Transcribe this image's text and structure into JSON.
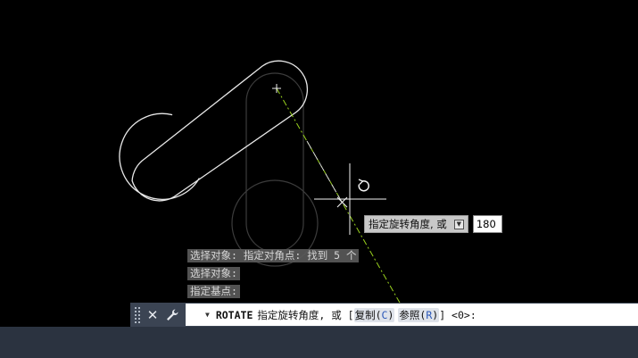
{
  "command_history": [
    "选择对象: 指定对角点: 找到 5 个",
    "选择对象:",
    "指定基点:"
  ],
  "dynamic_input": {
    "prompt": "指定旋转角度, 或",
    "value": "180"
  },
  "command_line": {
    "command": "ROTATE",
    "prompt": "指定旋转角度, 或 [",
    "options": [
      {
        "label": "复制(",
        "key": "C",
        "close": ")"
      },
      {
        "label": "参照(",
        "key": "R",
        "close": ")"
      }
    ],
    "suffix": "] <0>:"
  },
  "icons": {
    "grip": "grip-handle-icon",
    "close": "close-icon",
    "customize": "wrench-icon",
    "dropdown": "chevron-down-icon",
    "rotate_cursor": "rotate-cursor-icon",
    "base_point": "plus-icon"
  },
  "colors": {
    "background": "#000000",
    "active_geometry": "#e8e8e8",
    "ghost_geometry": "#3c3c3c",
    "rubberband": "#9ad21e",
    "command_bar": "#3b4453"
  }
}
